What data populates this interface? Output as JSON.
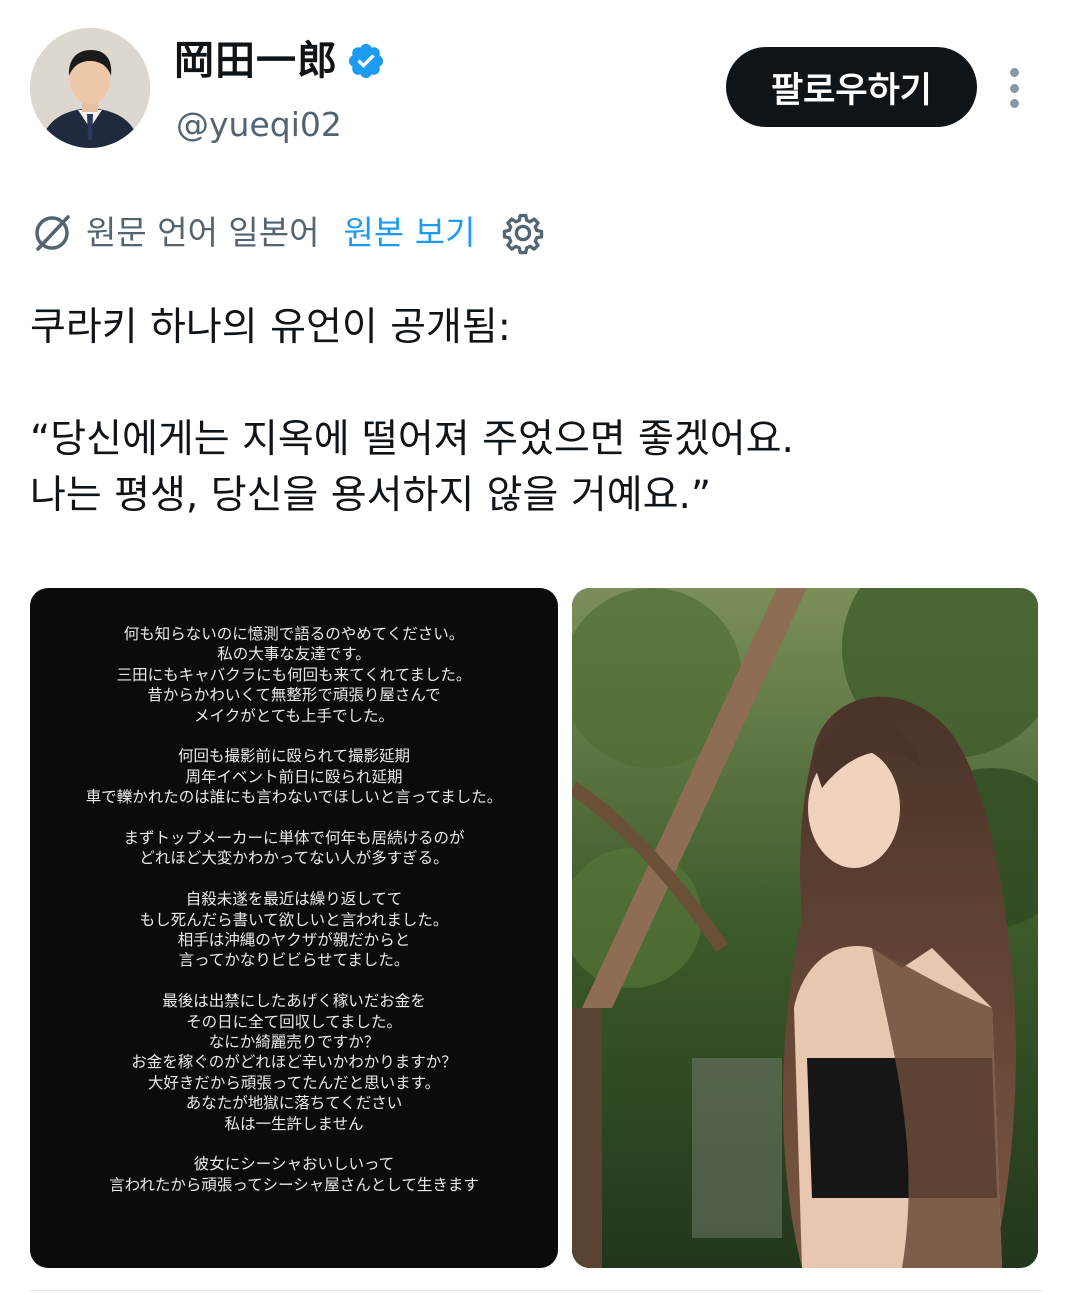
{
  "author": {
    "display_name": "岡田一郎",
    "handle": "@yueqi02"
  },
  "follow_label": "팔로우하기",
  "translation": {
    "label": "원문 언어 일본어",
    "view_original": "원본 보기"
  },
  "tweet": {
    "line1": "쿠라키 하나의 유언이 공개됨:",
    "quote": "“당신에게는 지옥에 떨어져 주었으면 좋겠어요.\n나는 평생, 당신을 용서하지 않을 거예요.”"
  },
  "media_text": [
    [
      "何も知らないのに憶測で語るのやめてください。",
      "私の大事な友達です。",
      "三田にもキャバクラにも何回も来てくれてました。",
      "昔からかわいくて無整形で頑張り屋さんで",
      "メイクがとても上手でした。"
    ],
    [
      "何回も撮影前に殴られて撮影延期",
      "周年イベント前日に殴られ延期",
      "車で轢かれたのは誰にも言わないでほしいと言ってました。"
    ],
    [
      "まずトップメーカーに単体で何年も居続けるのが",
      "どれほど大変かわかってない人が多すぎる。"
    ],
    [
      "自殺未遂を最近は繰り返してて",
      "もし死んだら書いて欲しいと言われました。",
      "相手は沖縄のヤクザが親だからと",
      "言ってかなりビビらせてました。"
    ],
    [
      "最後は出禁にしたあげく稼いだお金を",
      "その日に全て回収してました。",
      "なにか綺麗売りですか？",
      "お金を稼ぐのがどれほど辛いかわかりますか？",
      "大好きだから頑張ってたんだと思います。",
      "あなたが地獄に落ちてください",
      "私は一生許しません"
    ],
    [
      "彼女にシーシャおいしいって",
      "言われたから頑張ってシーシャ屋さんとして生きます"
    ]
  ],
  "colors": {
    "verified": "#1d9bf0",
    "link": "#1d9bf0",
    "secondary_text": "#536471",
    "follow_bg": "#0f1419"
  }
}
